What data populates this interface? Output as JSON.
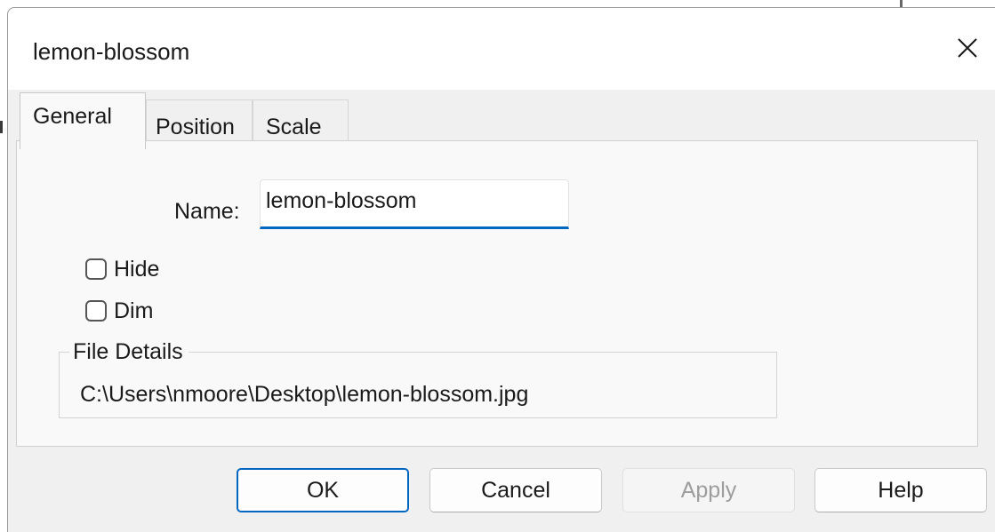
{
  "window": {
    "title": "lemon-blossom",
    "close_icon": "close-icon"
  },
  "tabs": [
    {
      "label": "General",
      "active": true
    },
    {
      "label": "Position",
      "active": false
    },
    {
      "label": "Scale",
      "active": false
    }
  ],
  "general": {
    "name_label": "Name:",
    "name_value": "lemon-blossom",
    "hide_label": "Hide",
    "hide_checked": false,
    "dim_label": "Dim",
    "dim_checked": false,
    "file_details": {
      "legend": "File Details",
      "path": "C:\\Users\\nmoore\\Desktop\\lemon-blossom.jpg"
    }
  },
  "buttons": {
    "ok": "OK",
    "cancel": "Cancel",
    "apply": "Apply",
    "apply_enabled": false,
    "help": "Help"
  },
  "colors": {
    "accent": "#0067c0",
    "disabled_text": "#9d9d9d"
  }
}
